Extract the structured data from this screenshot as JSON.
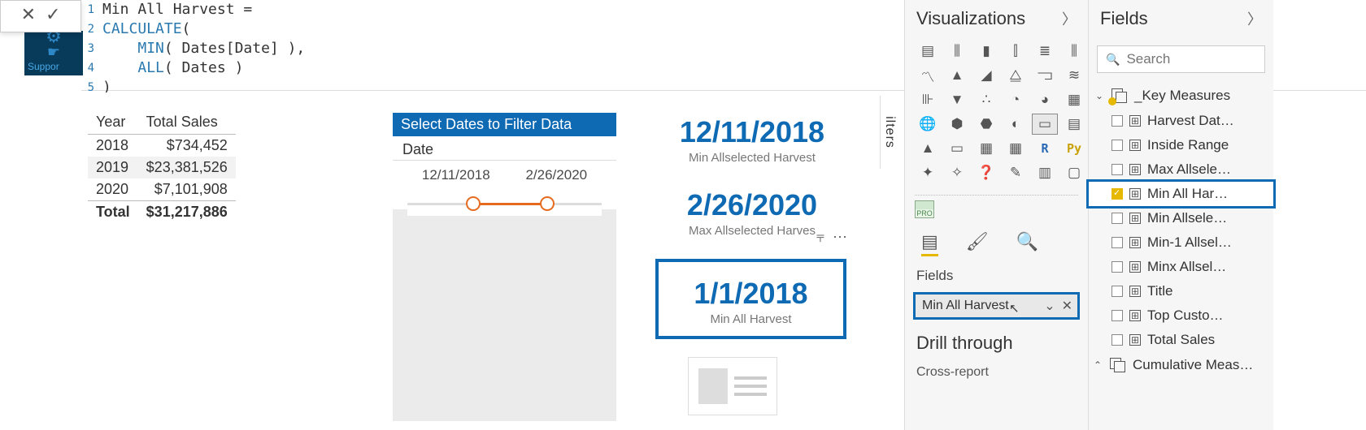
{
  "formula_bar": {
    "line_numbers": [
      "1",
      "2",
      "3",
      "4",
      "5"
    ],
    "lines": [
      {
        "plain_pre": "Min All Harvest = "
      },
      {
        "func": "CALCULATE",
        "after": "("
      },
      {
        "indent": "    ",
        "func": "MIN",
        "after": "( Dates[Date] ),"
      },
      {
        "indent": "    ",
        "func": "ALL",
        "after": "( Dates )"
      },
      {
        "plain_pre": ")"
      }
    ]
  },
  "support_label": "Suppor",
  "table": {
    "headers": [
      "Year",
      "Total Sales"
    ],
    "rows": [
      {
        "year": "2018",
        "val": "$734,452"
      },
      {
        "year": "2019",
        "val": "$23,381,526"
      },
      {
        "year": "2020",
        "val": "$7,101,908"
      }
    ],
    "total_label": "Total",
    "total_val": "$31,217,886"
  },
  "slicer": {
    "title": "Select Dates to Filter Data",
    "field": "Date",
    "start": "12/11/2018",
    "end": "2/26/2020"
  },
  "cards": {
    "c1_value": "12/11/2018",
    "c1_caption": "Min Allselected Harvest",
    "c2_value": "2/26/2020",
    "c2_caption": "Max Allselected Harves",
    "c3_value": "1/1/2018",
    "c3_caption": "Min All Harvest"
  },
  "filters_label": "ilters",
  "panes": {
    "vis_title": "Visualizations",
    "fields_title": "Fields",
    "search_placeholder": "Search",
    "section_fields": "Fields",
    "well_value": "Min All Harvest",
    "drill_title": "Drill through",
    "drill_sub": "Cross-report"
  },
  "viz_icons": [
    "stacked-bar",
    "clustered-bar",
    "stacked-col",
    "clustered-col",
    "stacked-bar-100",
    "clustered-col-100",
    "line",
    "area",
    "stacked-area",
    "line-col",
    "line-col2",
    "ribbon",
    "waterfall",
    "funnel",
    "scatter",
    "pie",
    "donut",
    "treemap",
    "map",
    "filled-map",
    "shape-map",
    "gauge",
    "card",
    "multi-card",
    "kpi",
    "slicer",
    "table",
    "matrix",
    "r",
    "py",
    "key-influencers",
    "decomp",
    "qa",
    "narrative",
    "paginated",
    "powerapps"
  ],
  "viz_glyphs": [
    "▤",
    "⫼",
    "▮",
    "⫿",
    "≣",
    "⫼",
    "〽",
    "▲",
    "◢",
    "⧋",
    "⫎",
    "≋",
    "⊪",
    "▼",
    "∴",
    "◔",
    "◕",
    "▦",
    "🌐",
    "⬢",
    "⬣",
    "◐",
    "▭",
    "▤",
    "▲",
    "▭",
    "▦",
    "▦",
    "R",
    "Py",
    "✦",
    "✧",
    "❓",
    "✎",
    "▥",
    "▢"
  ],
  "field_table": "_Key Measures",
  "field_table2": "Cumulative Meas…",
  "field_list": [
    {
      "name": "Harvest Dat…",
      "checked": false
    },
    {
      "name": "Inside Range",
      "checked": false
    },
    {
      "name": "Max Allsele…",
      "checked": false
    },
    {
      "name": "Min All Har…",
      "checked": true,
      "selected": true
    },
    {
      "name": "Min Allsele…",
      "checked": false
    },
    {
      "name": "Min-1 Allsel…",
      "checked": false
    },
    {
      "name": "Minx Allsel…",
      "checked": false
    },
    {
      "name": "Title",
      "checked": false
    },
    {
      "name": "Top Custo…",
      "checked": false
    },
    {
      "name": "Total Sales",
      "checked": false
    }
  ]
}
